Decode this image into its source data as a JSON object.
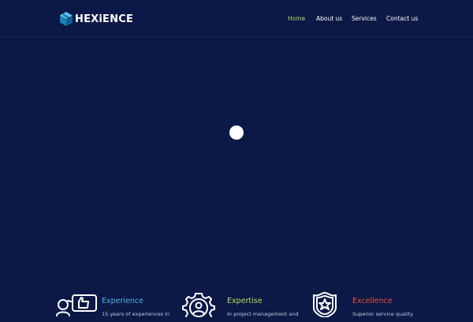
{
  "brand": {
    "name": "HEXiENCE"
  },
  "nav": {
    "items": [
      {
        "label": "Home",
        "active": true
      },
      {
        "label": "About us",
        "active": false
      },
      {
        "label": "Services",
        "active": false
      },
      {
        "label": "Contact us",
        "active": false
      }
    ]
  },
  "features": [
    {
      "title": "Experience",
      "description": "15 years of experiences in",
      "color": "#4fb3e0",
      "icon": "thumbs-up-person-icon"
    },
    {
      "title": "Expertise",
      "description": "In project management and",
      "color": "#a8e05f",
      "icon": "gear-person-icon"
    },
    {
      "title": "Excellence",
      "description": "Superior service quality",
      "color": "#e8503a",
      "icon": "star-shield-icon"
    }
  ],
  "colors": {
    "background": "#0c1846",
    "nav_active": "#a8e05f",
    "logo_accent": "#2ea3d8"
  }
}
